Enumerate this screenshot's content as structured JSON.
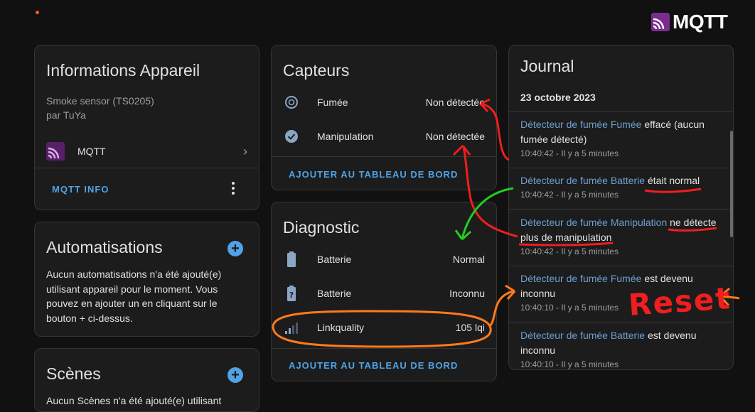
{
  "brand": {
    "name": "MQTT",
    "color": "#7b2d8e"
  },
  "device": {
    "title": "Informations Appareil",
    "model": "Smoke sensor (TS0205)",
    "manufacturer": "par TuYa",
    "integration": "MQTT",
    "action": "MQTT INFO"
  },
  "automations": {
    "title": "Automatisations",
    "text": "Aucun automatisations n'a été ajouté(e) utilisant appareil pour le moment. Vous pouvez en ajouter un en cliquant sur le bouton + ci-dessus."
  },
  "scenes": {
    "title": "Scènes",
    "text": "Aucun Scènes n'a été ajouté(e) utilisant"
  },
  "sensors": {
    "title": "Capteurs",
    "rows": [
      {
        "name": "Fumée",
        "value": "Non détectée",
        "icon": "smoke-detector-icon"
      },
      {
        "name": "Manipulation",
        "value": "Non détectée",
        "icon": "check-circle-icon"
      }
    ],
    "action": "AJOUTER AU TABLEAU DE BORD"
  },
  "diagnostic": {
    "title": "Diagnostic",
    "rows": [
      {
        "name": "Batterie",
        "value": "Normal",
        "icon": "battery-icon"
      },
      {
        "name": "Batterie",
        "value": "Inconnu",
        "icon": "battery-unknown-icon"
      },
      {
        "name": "Linkquality",
        "value": "105 lqi",
        "icon": "signal-icon"
      }
    ],
    "action": "AJOUTER AU TABLEAU DE BORD"
  },
  "journal": {
    "title": "Journal",
    "date": "23 octobre 2023",
    "entries": [
      {
        "source": "Détecteur de fumée Fumée",
        "message": "effacé (aucun fumée détecté)",
        "time": "10:40:42 - Il y a 5 minutes"
      },
      {
        "source": "Détecteur de fumée Batterie",
        "message": "était normal",
        "time": "10:40:42 - Il y a 5 minutes"
      },
      {
        "source": "Détecteur de fumée Manipulation",
        "message": "ne détecte plus de manipulation",
        "time": "10:40:42 - Il y a 5 minutes"
      },
      {
        "source": "Détecteur de fumée Fumée",
        "message": "est devenu inconnu",
        "time": "10:40:10 - Il y a 5 minutes"
      },
      {
        "source": "Détecteur de fumée Batterie",
        "message": "est devenu inconnu",
        "time": "10:40:10 - Il y a 5 minutes"
      }
    ]
  },
  "annotation": {
    "label": "Reset"
  },
  "colors": {
    "accent": "#4fa3e6",
    "annotation_red": "#f01e1e",
    "annotation_green": "#22cc22",
    "annotation_orange": "#ff7a1a"
  }
}
